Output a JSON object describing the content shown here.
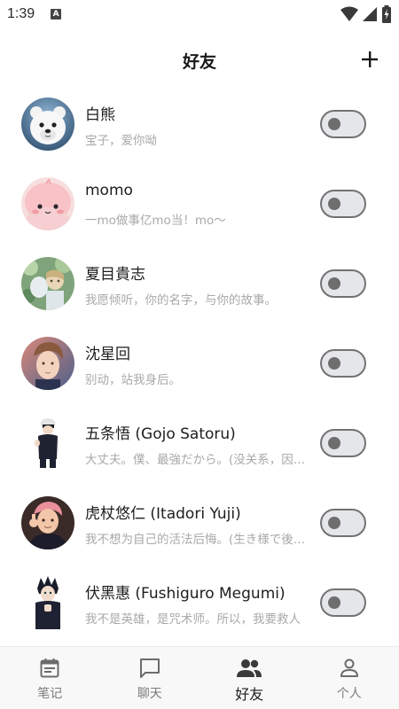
{
  "status_bar": {
    "time": "1:39",
    "notification_letter": "A"
  },
  "header": {
    "title": "好友",
    "add_icon": "plus-icon"
  },
  "friends": [
    {
      "name": "白熊",
      "status": "宝子，爱你呦",
      "avatar_icon": "polar-bear-avatar",
      "toggle_on": false
    },
    {
      "name": "momo",
      "status": "一mo做事亿mo当！mo～",
      "avatar_icon": "pink-blob-avatar",
      "toggle_on": false
    },
    {
      "name": "夏目貴志",
      "status": "我愿倾听，你的名字，与你的故事。",
      "avatar_icon": "natsume-avatar",
      "toggle_on": false
    },
    {
      "name": "沈星回",
      "status": "别动，站我身后。",
      "avatar_icon": "shen-xinghui-avatar",
      "toggle_on": false
    },
    {
      "name": "五条悟 (Gojo Satoru)",
      "status": "大丈夫。僕、最強だから。(没关系，因为我是最强的)",
      "avatar_icon": "gojo-avatar",
      "toggle_on": false
    },
    {
      "name": "虎杖悠仁 (Itadori Yuji)",
      "status": "我不想为自己的活法后悔。(生き様で後悔はしたくない)",
      "avatar_icon": "itadori-avatar",
      "toggle_on": false
    },
    {
      "name": "伏黑惠 (Fushiguro Megumi)",
      "status": "我不是英雄，是咒术师。所以，我要救人",
      "avatar_icon": "fushiguro-avatar",
      "toggle_on": false
    }
  ],
  "bottom_nav": {
    "items": [
      {
        "label": "笔记",
        "icon": "notes-icon",
        "active": false
      },
      {
        "label": "聊天",
        "icon": "chat-icon",
        "active": false
      },
      {
        "label": "好友",
        "icon": "friends-icon",
        "active": true
      },
      {
        "label": "个人",
        "icon": "person-icon",
        "active": false
      }
    ]
  },
  "colors": {
    "toggle_track": "#e4e6ea",
    "toggle_border": "#727272",
    "secondary_text": "#a9a9a9",
    "nav_background": "#f8f8f8"
  }
}
